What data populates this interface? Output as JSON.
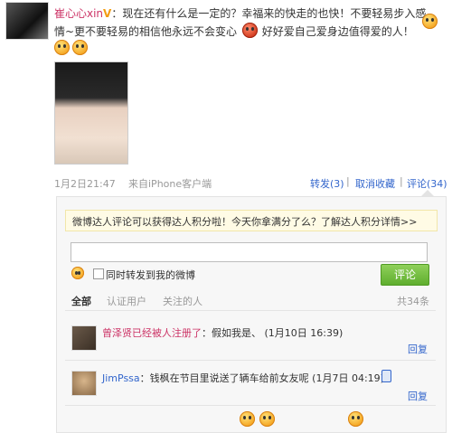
{
  "post": {
    "username": "崔心心xin",
    "text_line1": "：现在还有什么是一定的？幸福来的快走的也快！不要轻易步入感",
    "text_line2a": "情~更不要轻易的相信他永远不会变心",
    "text_line2b": "好好爱自己爱身边值得爱的人！",
    "timestamp": "1月2日21:47",
    "source": "来自iPhone客户端",
    "repost": "转发(3)",
    "cancel_fav": "取消收藏",
    "comment": "评论(34)"
  },
  "comments_panel": {
    "notice": "微博达人评论可以获得达人积分啦！今天你拿满分了么？了解达人积分详情>>",
    "input_value": "",
    "also_repost": "同时转发到我的微博",
    "submit": "评论",
    "filters": [
      "全部",
      "认证用户",
      "关注的人"
    ],
    "total": "共34条",
    "items": [
      {
        "author": "曾泽贤已经被人注册了",
        "text": "：假如我是、 (1月10日 16:39)",
        "reply": "回复"
      },
      {
        "author": "JimPssa",
        "text": "：钱枫在节目里说送了辆车给前女友呢 (1月7日 04:19)",
        "reply": "回复"
      }
    ]
  },
  "colors": {
    "link": "#3366cc",
    "username": "#cc3366",
    "button_green": "#5fae2e"
  }
}
